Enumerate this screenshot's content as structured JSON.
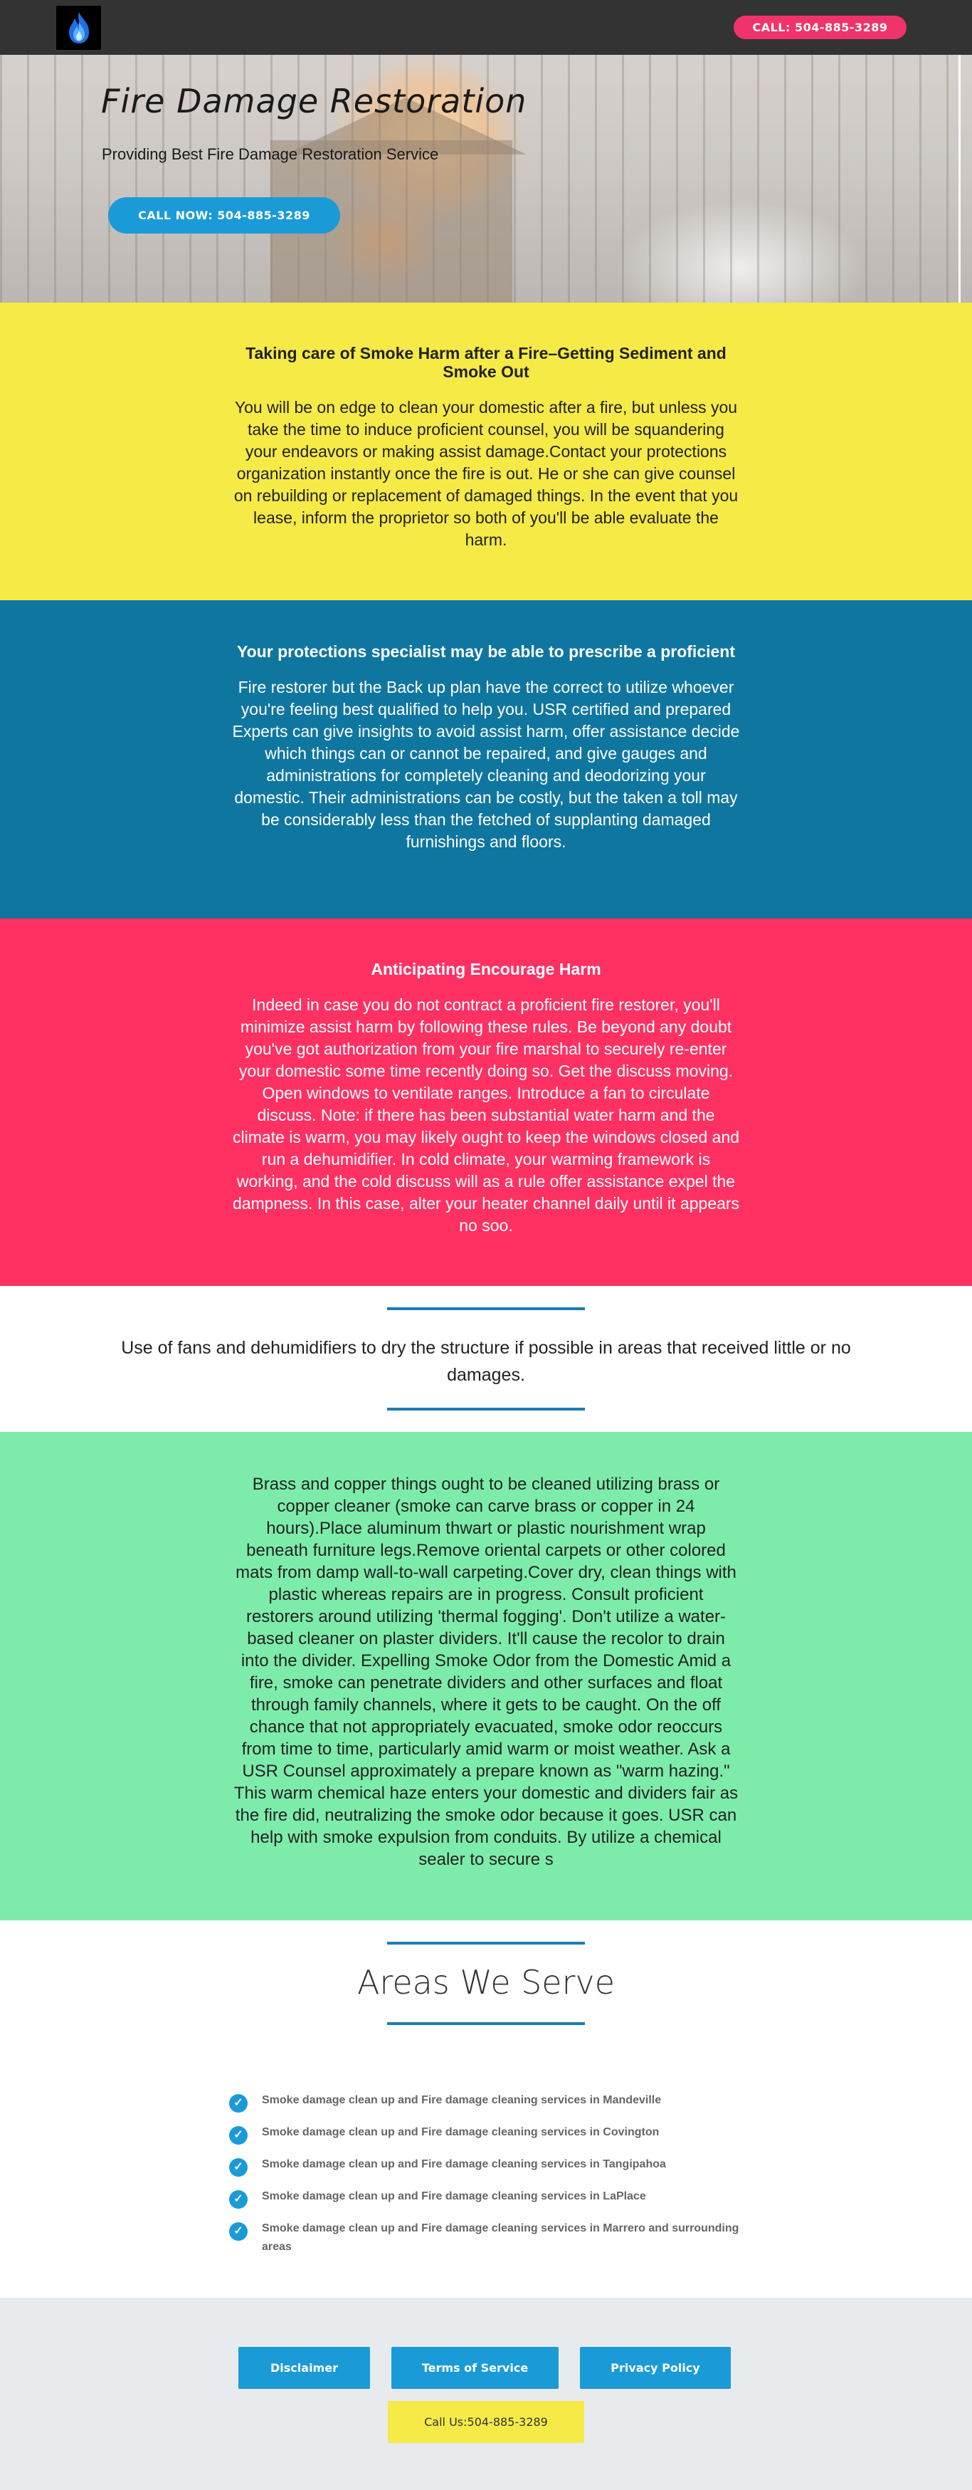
{
  "header": {
    "logo_icon": "blue-flame-icon",
    "call_label": "CALL: 504-885-3289"
  },
  "hero": {
    "title": "Fire Damage Restoration",
    "subtitle": "Providing Best Fire Damage Restoration Service",
    "cta_label": "CALL NOW: 504-885-3289"
  },
  "sections": [
    {
      "title": "Taking care of Smoke Harm after a Fire–Getting Sediment and Smoke Out",
      "body": "You will be on edge to clean your domestic after a fire, but unless you take the time to induce proficient counsel, you will be squandering your endeavors or making assist damage.Contact your protections organization instantly once the fire is out. He or she can give counsel on rebuilding or replacement of damaged things. In the event that you lease, inform the proprietor so both of you'll be able evaluate the harm.",
      "bg": "#f6ea47"
    },
    {
      "title": "Your protections specialist may be able to prescribe a proficient",
      "body": "Fire restorer but the Back up plan have the correct to utilize whoever you're feeling best qualified to help you. USR certified and prepared Experts can give insights to avoid assist harm, offer assistance decide which things can or cannot be repaired, and give gauges and administrations for completely cleaning and deodorizing your domestic. Their administrations can be costly, but the taken a toll may be considerably less than the fetched of supplanting damaged furnishings and floors.",
      "bg": "#0f76a0"
    },
    {
      "title": "Anticipating Encourage Harm",
      "body": "Indeed in case you do not contract a proficient fire restorer, you'll minimize assist harm by following these rules. Be beyond any doubt you've got authorization from your fire marshal to securely re-enter your domestic some time recently doing so. Get the discuss moving. Open windows to ventilate ranges. Introduce a fan to circulate discuss. Note: if there has been substantial water harm and the climate is warm, you may likely ought to keep the windows closed and run a dehumidifier. In cold climate, your warming framework is working, and the cold discuss will as a rule offer assistance expel the dampness. In this case, alter your heater channel daily until it appears no soo.",
      "bg": "#fe3162"
    }
  ],
  "callout": {
    "text": "Use of fans and dehumidifiers to dry the structure if possible in areas that received little or no damages."
  },
  "long_section": {
    "body": "Brass and copper things ought to be cleaned utilizing brass or copper cleaner (smoke can carve brass or copper in 24 hours).Place aluminum thwart or plastic nourishment wrap beneath furniture legs.Remove oriental carpets or other colored mats from damp wall-to-wall carpeting.Cover dry, clean things with plastic whereas repairs are in progress. Consult proficient restorers around utilizing 'thermal fogging'. Don't utilize a water-based cleaner on plaster dividers. It'll cause the recolor to drain into the divider. Expelling Smoke Odor from the Domestic Amid a fire, smoke can penetrate dividers and other surfaces and float through family channels, where it gets to be caught. On the off chance that not appropriately evacuated, smoke odor reoccurs from time to time, particularly amid warm or moist weather. Ask a USR Counsel approximately a prepare known as \"warm hazing.\" This warm chemical haze enters your domestic and dividers fair as the fire did, neutralizing the smoke odor because it goes. USR can help with smoke expulsion from conduits. By utilize a chemical sealer to secure s",
    "bg": "#7decab"
  },
  "areas": {
    "title": "Areas We Serve",
    "check_icon": "check-circle-icon",
    "items": [
      "Smoke damage clean up and Fire damage cleaning services in Mandeville",
      "Smoke damage clean up and Fire damage cleaning services in Covington",
      "Smoke damage clean up and Fire damage cleaning services in Tangipahoa",
      "Smoke damage clean up and Fire damage cleaning services in LaPlace",
      "Smoke damage clean up and Fire damage cleaning services in Marrero and surrounding areas"
    ]
  },
  "footer": {
    "disclaimer_label": "Disclaimer",
    "terms_label": "Terms of Service",
    "privacy_label": "Privacy Policy",
    "call_label": "Call Us:504-885-3289",
    "accent": "#1a9bd7",
    "call_bg": "#f6ea47"
  }
}
